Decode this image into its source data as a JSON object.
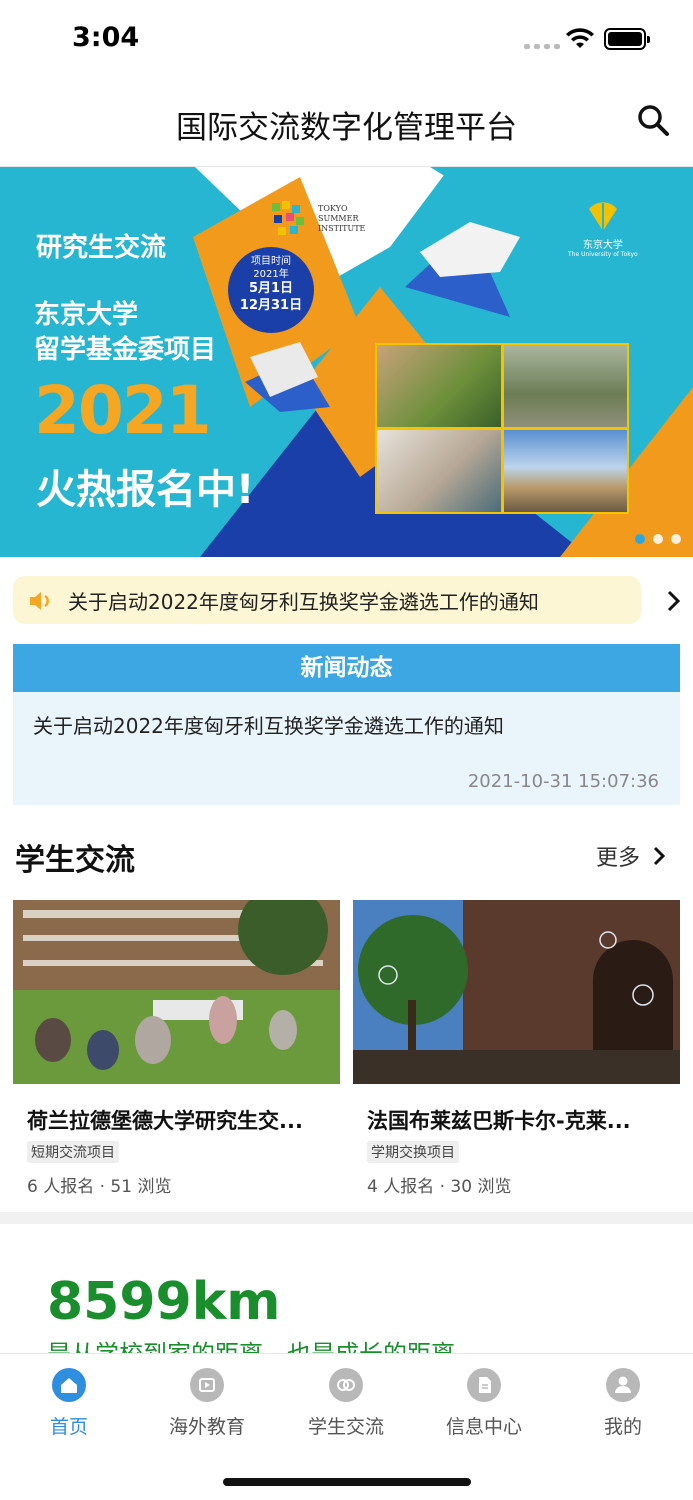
{
  "status_bar": {
    "time": "3:04"
  },
  "header": {
    "title": "国际交流数字化管理平台"
  },
  "banner": {
    "line1": "研究生交流",
    "line2": "东京大学",
    "line3": "留学基金委项目",
    "year": "2021",
    "cta": "火热报名中!",
    "circle": {
      "label": "项目时间",
      "year": "2021年",
      "start": "5月1日",
      "end": "12月31日"
    },
    "tsi": {
      "l1": "TOKYO",
      "l2": "SUMMER",
      "l3": "INSTITUTE"
    },
    "ut": {
      "name": "东京大学",
      "en": "The University of Tokyo"
    },
    "slide_count": 3,
    "active_slide": 1
  },
  "notice": {
    "text": "关于启动2022年度匈牙利互换奖学金遴选工作的通知"
  },
  "news": {
    "header": "新闻动态",
    "item_title": "关于启动2022年度匈牙利互换奖学金遴选工作的通知",
    "item_time": "2021-10-31 15:07:36"
  },
  "student_exchange": {
    "title": "学生交流",
    "more": "更多",
    "cards": [
      {
        "title": "荷兰拉德堡德大学研究生交...",
        "tag": "短期交流项目",
        "stats": "6 人报名 · 51 浏览"
      },
      {
        "title": "法国布莱兹巴斯卡尔-克莱...",
        "tag": "学期交换项目",
        "stats": "4 人报名 · 30 浏览"
      }
    ]
  },
  "distance": {
    "value": "8599km",
    "subtitle": "是从学校到家的距离，也是成长的距离"
  },
  "tabbar": {
    "tabs": [
      {
        "label": "首页",
        "icon": "home-icon",
        "active": true
      },
      {
        "label": "海外教育",
        "icon": "video-icon",
        "active": false
      },
      {
        "label": "学生交流",
        "icon": "link-icon",
        "active": false
      },
      {
        "label": "信息中心",
        "icon": "document-icon",
        "active": false
      },
      {
        "label": "我的",
        "icon": "user-icon",
        "active": false
      }
    ]
  },
  "colors": {
    "accent": "#2e8ee0",
    "news_header": "#3ca7e2",
    "distance_green": "#1a8e2d",
    "banner_orange": "#f29a1b",
    "banner_blue": "#1b3fa8"
  }
}
